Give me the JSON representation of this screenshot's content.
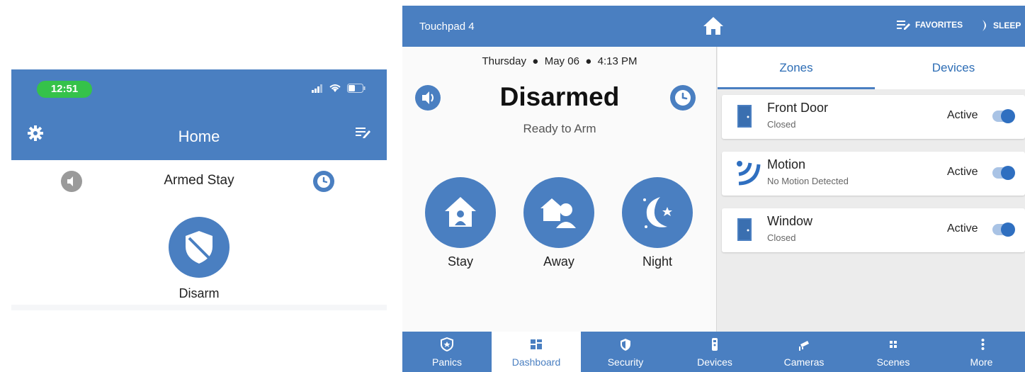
{
  "phone": {
    "time": "12:51",
    "title": "Home",
    "arm_status": "Armed Stay",
    "disarm_label": "Disarm"
  },
  "touchpad": {
    "device_name": "Touchpad 4",
    "favorites": "FAVORITES",
    "sleep": "SLEEP",
    "date_day": "Thursday",
    "date": "May 06",
    "time": "4:13 PM",
    "state": "Disarmed",
    "substate": "Ready to Arm",
    "arm_buttons": [
      {
        "label": "Stay",
        "icon": "house-person-icon"
      },
      {
        "label": "Away",
        "icon": "house-away-icon"
      },
      {
        "label": "Night",
        "icon": "moon-star-icon"
      }
    ],
    "tabs": [
      {
        "label": "Zones",
        "active": true
      },
      {
        "label": "Devices",
        "active": false
      }
    ],
    "zones": [
      {
        "name": "Front Door",
        "state": "Closed",
        "status": "Active",
        "icon": "door-icon",
        "toggle_on": true
      },
      {
        "name": "Motion",
        "state": "No Motion Detected",
        "status": "Active",
        "icon": "motion-sensor-icon",
        "toggle_on": true
      },
      {
        "name": "Window",
        "state": "Closed",
        "status": "Active",
        "icon": "window-icon",
        "toggle_on": true
      }
    ],
    "nav": [
      {
        "label": "Panics",
        "icon": "star-shield-icon",
        "active": false
      },
      {
        "label": "Dashboard",
        "icon": "dashboard-grid-icon",
        "active": true
      },
      {
        "label": "Security",
        "icon": "shield-icon",
        "active": false
      },
      {
        "label": "Devices",
        "icon": "remote-icon",
        "active": false
      },
      {
        "label": "Cameras",
        "icon": "camera-icon",
        "active": false
      },
      {
        "label": "Scenes",
        "icon": "scenes-icon",
        "active": false
      },
      {
        "label": "More",
        "icon": "more-vertical-icon",
        "active": false
      }
    ]
  },
  "colors": {
    "primary": "#4a7fc1",
    "status_green": "#35c24a",
    "toggle_on": "#2f6fc0"
  }
}
